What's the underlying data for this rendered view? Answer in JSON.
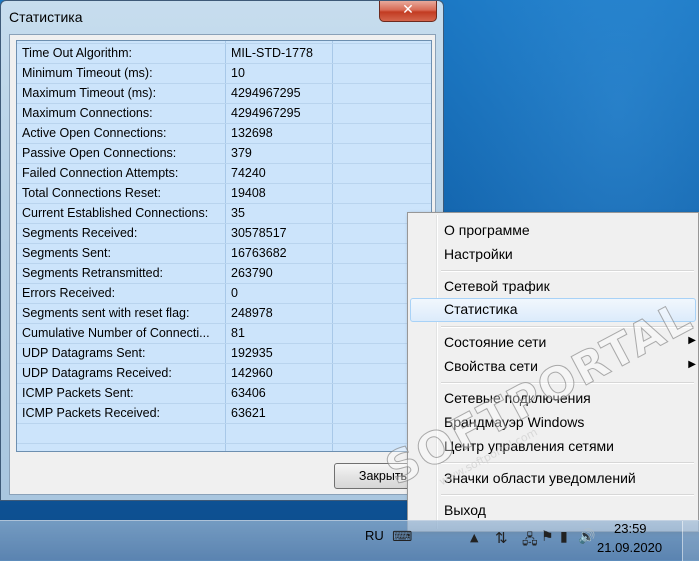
{
  "window": {
    "title": "Статистика",
    "close_glyph": "✕",
    "close_button_label": "Закрыть"
  },
  "stats": [
    {
      "name": "Time Out Algorithm:",
      "value": "MIL-STD-1778"
    },
    {
      "name": "Minimum Timeout (ms):",
      "value": "10"
    },
    {
      "name": "Maximum Timeout (ms):",
      "value": "4294967295"
    },
    {
      "name": "Maximum Connections:",
      "value": "4294967295"
    },
    {
      "name": "Active Open Connections:",
      "value": "132698"
    },
    {
      "name": "Passive Open Connections:",
      "value": "379"
    },
    {
      "name": "Failed Connection Attempts:",
      "value": "74240"
    },
    {
      "name": "Total Connections Reset:",
      "value": "19408"
    },
    {
      "name": "Current Established Connections:",
      "value": "35"
    },
    {
      "name": "Segments Received:",
      "value": "30578517"
    },
    {
      "name": "Segments Sent:",
      "value": "16763682"
    },
    {
      "name": "Segments Retransmitted:",
      "value": "263790"
    },
    {
      "name": "Errors Received:",
      "value": "0"
    },
    {
      "name": "Segments sent with reset flag:",
      "value": "248978"
    },
    {
      "name": "Cumulative Number of Connecti...",
      "value": "81"
    },
    {
      "name": "UDP Datagrams Sent:",
      "value": "192935"
    },
    {
      "name": "UDP Datagrams Received:",
      "value": "142960"
    },
    {
      "name": "ICMP Packets Sent:",
      "value": "63406"
    },
    {
      "name": "ICMP Packets Received:",
      "value": "63621"
    }
  ],
  "menu": {
    "items": [
      {
        "label": "О программе"
      },
      {
        "label": "Настройки"
      },
      {
        "label": "Сетевой трафик"
      },
      {
        "label": "Статистика"
      },
      {
        "label": "Состояние сети",
        "arrow": "▶"
      },
      {
        "label": "Свойства сети",
        "arrow": "▶"
      },
      {
        "label": "Сетевые подключения"
      },
      {
        "label": "Брандмауэр Windows"
      },
      {
        "label": "Центр управления сетями"
      },
      {
        "label": "Значки области уведомлений"
      },
      {
        "label": "Выход"
      }
    ]
  },
  "taskbar": {
    "language": "RU",
    "time": "23:59",
    "date": "21.09.2020"
  },
  "watermark": {
    "main": "SOFTPORTAL",
    "sub": "www.softportal.com"
  },
  "colors": {
    "list_bg": "#cce4fb",
    "desktop": "#1467b0",
    "menu_highlight_border": "#a8d2f7"
  }
}
